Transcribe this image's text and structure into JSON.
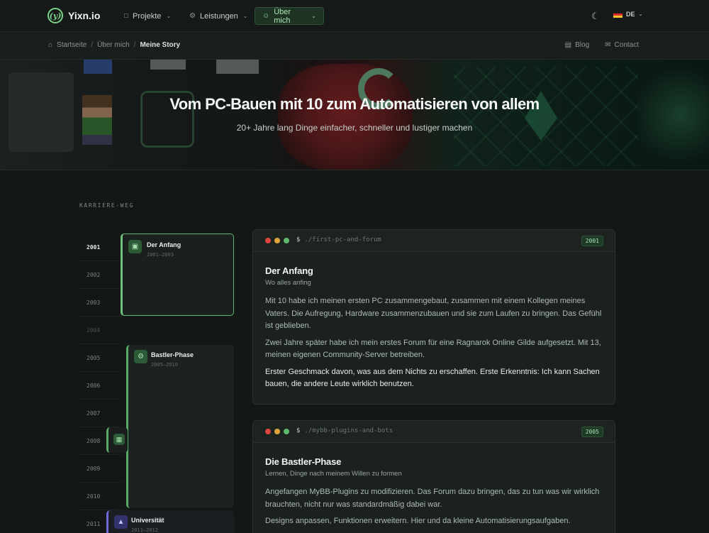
{
  "brand": {
    "name": "Yixn.io",
    "mark": "(y)"
  },
  "nav": {
    "items": [
      {
        "label": "Projekte",
        "icon": "folder-icon"
      },
      {
        "label": "Leistungen",
        "icon": "gear-icon"
      },
      {
        "label": "Über mich",
        "icon": "user-icon",
        "active": true
      }
    ],
    "language": "DE"
  },
  "breadcrumb": {
    "items": [
      "Startseite",
      "Über mich",
      "Meine Story"
    ],
    "links": [
      "Blog",
      "Contact"
    ]
  },
  "hero": {
    "title": "Vom PC-Bauen mit 10 zum Automatisieren von allem",
    "subtitle": "20+ Jahre lang Dinge einfacher, schneller und lustiger machen"
  },
  "section_label": "KARRIERE-WEG",
  "timeline": {
    "years": [
      "2001",
      "2002",
      "2003",
      "2004",
      "2005",
      "2006",
      "2007",
      "2008",
      "2009",
      "2010",
      "2011"
    ],
    "cards": [
      {
        "title": "Der Anfang",
        "range": "2001–2003"
      },
      {
        "title": "Bastler-Phase",
        "range": "2005–2010"
      },
      {
        "title": "Universität",
        "range": "2011–2012"
      }
    ]
  },
  "stories": [
    {
      "command": "./first-pc-and-forum",
      "year": "2001",
      "title": "Der Anfang",
      "subtitle": "Wo alles anfing",
      "paragraphs": [
        "Mit 10 habe ich meinen ersten PC zusammengebaut, zusammen mit einem Kollegen meines Vaters. Die Aufregung, Hardware zusammenzubauen und sie zum Laufen zu bringen. Das Gefühl ist geblieben.",
        "Zwei Jahre später habe ich mein erstes Forum für eine Ragnarok Online Gilde aufgesetzt. Mit 13, meinen eigenen Community-Server betreiben.",
        "Erster Geschmack davon, was aus dem Nichts zu erschaffen. Erste Erkenntnis: Ich kann Sachen bauen, die andere Leute wirklich benutzen."
      ]
    },
    {
      "command": "./mybb-plugins-and-bots",
      "year": "2005",
      "title": "Die Bastler-Phase",
      "subtitle": "Lernen, Dinge nach meinem Willen zu formen",
      "paragraphs": [
        "Angefangen MyBB-Plugins zu modifizieren. Das Forum dazu bringen, das zu tun was wir wirklich brauchten, nicht nur was standardmäßig dabei war.",
        "Designs anpassen, Funktionen erweitern. Hier und da kleine Automatisierungsaufgaben."
      ]
    }
  ],
  "colors": {
    "accent": "#6fc27e",
    "background": "#131715",
    "card": "#1b211e",
    "uni_accent": "#6d6ad6"
  }
}
